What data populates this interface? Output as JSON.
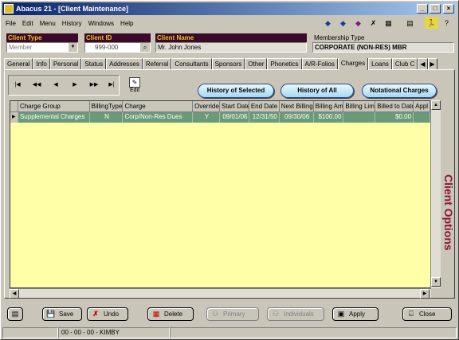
{
  "window": {
    "title": "Abacus 21 - [Client Maintenance]"
  },
  "menu": [
    "File",
    "Edit",
    "Menu",
    "History",
    "Windows",
    "Help"
  ],
  "fields": {
    "client_type": {
      "label": "Client Type",
      "value": "Member"
    },
    "client_id": {
      "label": "Client ID",
      "value": "999-000"
    },
    "client_name": {
      "label": "Client Name",
      "value": "Mr. John  Jones"
    },
    "membership_type": {
      "label": "Membership Type",
      "value": "CORPORATE (NON-RES) MBR"
    }
  },
  "tabs": [
    "General",
    "Info",
    "Personal",
    "Status",
    "Addresses",
    "Referral",
    "Consultants",
    "Sponsors",
    "Other",
    "Phonetics",
    "A/R-Folios",
    "Charges",
    "Loans",
    "Club C"
  ],
  "active_tab": "Charges",
  "edit_label": "Edit",
  "pills": {
    "history_selected": "History of Selected",
    "history_all": "History of All",
    "notational": "Notational Charges"
  },
  "grid": {
    "columns": [
      "Charge Group",
      "BillingType",
      "Charge",
      "Override",
      "Start Date",
      "End Date",
      "Next Billing",
      "Billing Amt",
      "Billing Limit",
      "Billed to Date",
      "Appl"
    ],
    "rows": [
      [
        "Supplemental Charges",
        "N",
        "Corp/Non-Res Dues",
        "Y",
        "09/01/06",
        "12/31/50",
        "09/30/06",
        "$100.00",
        "",
        "$0.00",
        ""
      ]
    ]
  },
  "sidebar_label": "Client Options",
  "actions": {
    "save": "Save",
    "undo": "Undo",
    "delete": "Delete",
    "primary": "Primary",
    "individuals": "Individuals",
    "apply": "Apply",
    "close": "Close"
  },
  "status": {
    "user": "00 - 00 - 00 - KIMBY"
  }
}
